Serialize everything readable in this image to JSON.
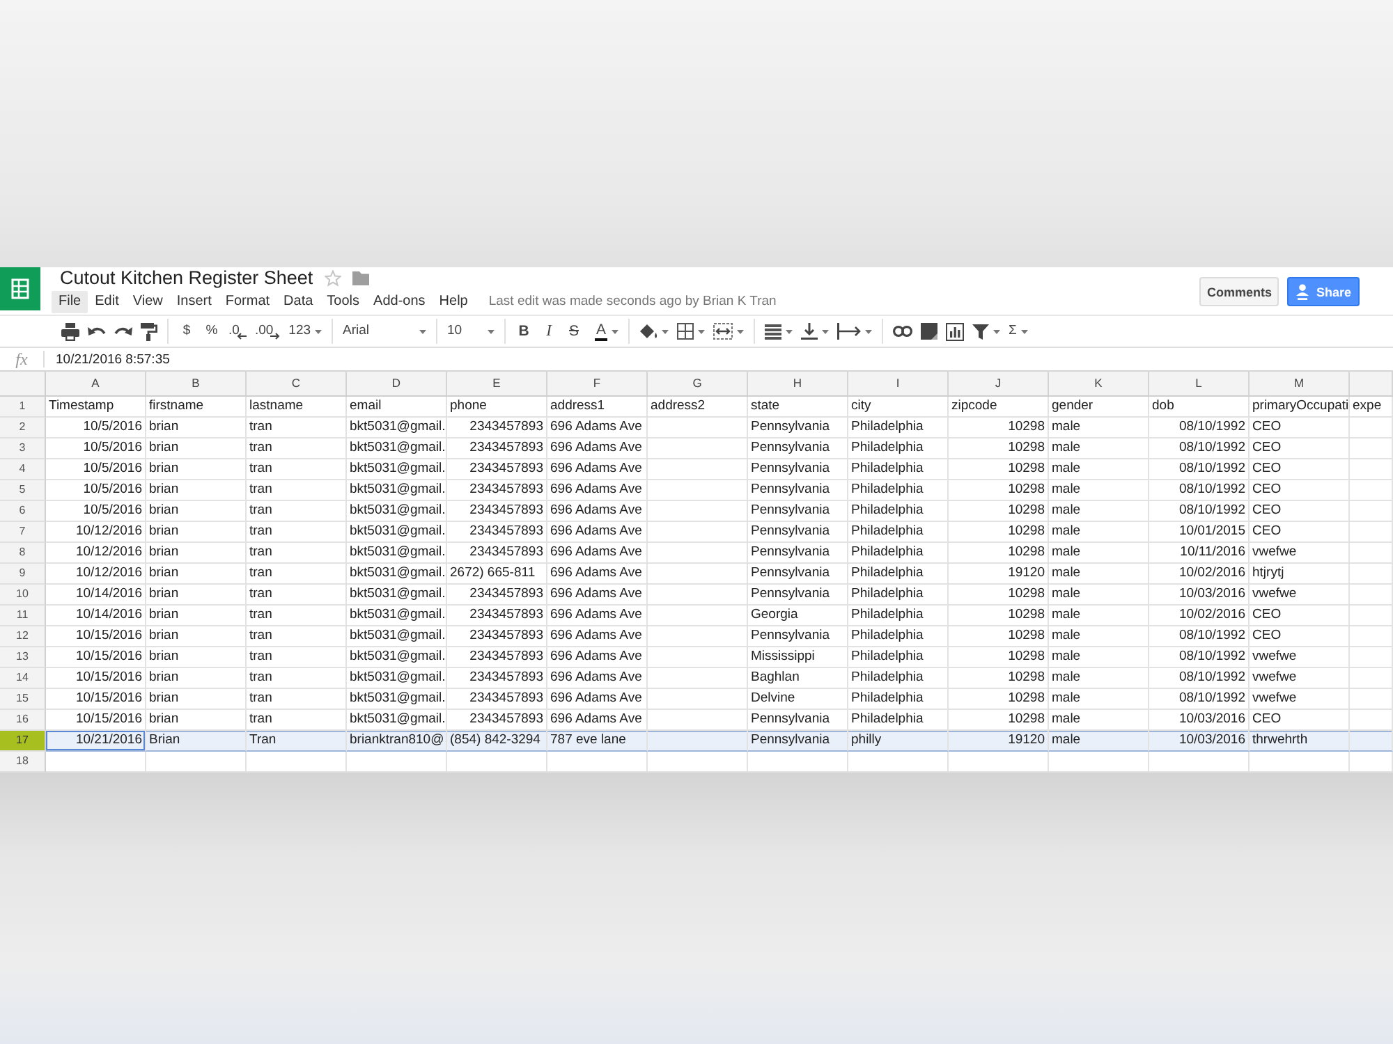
{
  "document": {
    "title": "Cutout Kitchen Register Sheet",
    "starred": false
  },
  "menu": [
    {
      "label": "File",
      "selected": true
    },
    {
      "label": "Edit",
      "selected": false
    },
    {
      "label": "View",
      "selected": false
    },
    {
      "label": "Insert",
      "selected": false
    },
    {
      "label": "Format",
      "selected": false
    },
    {
      "label": "Data",
      "selected": false
    },
    {
      "label": "Tools",
      "selected": false
    },
    {
      "label": "Add-ons",
      "selected": false
    },
    {
      "label": "Help",
      "selected": false
    }
  ],
  "last_edit": "Last edit was made seconds ago by Brian K Tran",
  "header_buttons": [
    {
      "label": "Comments",
      "kind": "plain"
    },
    {
      "label": "Share",
      "kind": "primary"
    }
  ],
  "toolbar": [
    [
      {
        "kind": "icon"
      },
      {
        "kind": "icon"
      },
      {
        "kind": "icon"
      },
      {
        "kind": "icon"
      }
    ],
    [
      {
        "kind": "glyph",
        "text": "$"
      },
      {
        "kind": "glyph",
        "text": "%"
      },
      {
        "kind": "shiftleft",
        "text": ".0"
      },
      {
        "kind": "shiftright",
        "text": ".00"
      },
      {
        "kind": "glyphmenu",
        "text": "123"
      }
    ],
    [
      {
        "kind": "select",
        "text": "Arial"
      }
    ],
    [
      {
        "kind": "select",
        "text": "10"
      }
    ],
    [
      {
        "kind": "bold",
        "text": "B"
      },
      {
        "kind": "italic",
        "text": "I"
      },
      {
        "kind": "strike",
        "text": "S"
      },
      {
        "kind": "colormenu",
        "text": "A"
      }
    ],
    [
      {
        "kind": "iconmenu"
      },
      {
        "kind": "iconmenu"
      },
      {
        "kind": "iconmenu"
      }
    ],
    [
      {
        "kind": "iconmenu"
      },
      {
        "kind": "iconmenu"
      },
      {
        "kind": "iconmenu"
      }
    ],
    [
      {
        "kind": "icon"
      },
      {
        "kind": "icon"
      },
      {
        "kind": "icon"
      },
      {
        "kind": "iconmenu"
      },
      {
        "kind": "glyphmenu",
        "text": "Σ"
      }
    ]
  ],
  "formula_bar": {
    "label": "fx",
    "value": "10/21/2016 8:57:35"
  },
  "grid": {
    "columns": [
      "A",
      "B",
      "C",
      "D",
      "E",
      "F",
      "G",
      "H",
      "I",
      "J",
      "K",
      "L",
      "M"
    ],
    "rows": [
      {
        "number": "1",
        "selected": false,
        "cells": [
          {
            "kind": "text",
            "text": "Timestamp",
            "active": false
          },
          {
            "kind": "text",
            "text": "firstname",
            "active": false
          },
          {
            "kind": "text",
            "text": "lastname",
            "active": false
          },
          {
            "kind": "text",
            "text": "email",
            "active": false
          },
          {
            "kind": "text",
            "text": "phone",
            "active": false
          },
          {
            "kind": "text",
            "text": "address1",
            "active": false
          },
          {
            "kind": "text",
            "text": "address2",
            "active": false
          },
          {
            "kind": "text",
            "text": "state",
            "active": false
          },
          {
            "kind": "text",
            "text": "city",
            "active": false
          },
          {
            "kind": "text",
            "text": "zipcode",
            "active": false
          },
          {
            "kind": "text",
            "text": "gender",
            "active": false
          },
          {
            "kind": "text",
            "text": "dob",
            "active": false
          },
          {
            "kind": "text",
            "text": "primaryOccupati",
            "active": false
          },
          {
            "kind": "text",
            "text": "expe",
            "active": false
          }
        ]
      },
      {
        "number": "2",
        "selected": false,
        "cells": [
          {
            "kind": "number",
            "text": "10/5/2016",
            "active": false
          },
          {
            "kind": "text",
            "text": "brian",
            "active": false
          },
          {
            "kind": "text",
            "text": "tran",
            "active": false
          },
          {
            "kind": "text",
            "text": "bkt5031@gmail.",
            "active": false
          },
          {
            "kind": "number",
            "text": "2343457893",
            "active": false
          },
          {
            "kind": "text",
            "text": "696 Adams Ave",
            "active": false
          },
          {
            "kind": "empty",
            "active": false
          },
          {
            "kind": "text",
            "text": "Pennsylvania",
            "active": false
          },
          {
            "kind": "text",
            "text": "Philadelphia",
            "active": false
          },
          {
            "kind": "number",
            "text": "10298",
            "active": false
          },
          {
            "kind": "text",
            "text": "male",
            "active": false
          },
          {
            "kind": "number",
            "text": "08/10/1992",
            "active": false
          },
          {
            "kind": "text",
            "text": "CEO",
            "active": false
          }
        ]
      },
      {
        "number": "3",
        "selected": false,
        "cells": [
          {
            "kind": "number",
            "text": "10/5/2016",
            "active": false
          },
          {
            "kind": "text",
            "text": "brian",
            "active": false
          },
          {
            "kind": "text",
            "text": "tran",
            "active": false
          },
          {
            "kind": "text",
            "text": "bkt5031@gmail.",
            "active": false
          },
          {
            "kind": "number",
            "text": "2343457893",
            "active": false
          },
          {
            "kind": "text",
            "text": "696 Adams Ave",
            "active": false
          },
          {
            "kind": "empty",
            "active": false
          },
          {
            "kind": "text",
            "text": "Pennsylvania",
            "active": false
          },
          {
            "kind": "text",
            "text": "Philadelphia",
            "active": false
          },
          {
            "kind": "number",
            "text": "10298",
            "active": false
          },
          {
            "kind": "text",
            "text": "male",
            "active": false
          },
          {
            "kind": "number",
            "text": "08/10/1992",
            "active": false
          },
          {
            "kind": "text",
            "text": "CEO",
            "active": false
          }
        ]
      },
      {
        "number": "4",
        "selected": false,
        "cells": [
          {
            "kind": "number",
            "text": "10/5/2016",
            "active": false
          },
          {
            "kind": "text",
            "text": "brian",
            "active": false
          },
          {
            "kind": "text",
            "text": "tran",
            "active": false
          },
          {
            "kind": "text",
            "text": "bkt5031@gmail.",
            "active": false
          },
          {
            "kind": "number",
            "text": "2343457893",
            "active": false
          },
          {
            "kind": "text",
            "text": "696 Adams Ave",
            "active": false
          },
          {
            "kind": "empty",
            "active": false
          },
          {
            "kind": "text",
            "text": "Pennsylvania",
            "active": false
          },
          {
            "kind": "text",
            "text": "Philadelphia",
            "active": false
          },
          {
            "kind": "number",
            "text": "10298",
            "active": false
          },
          {
            "kind": "text",
            "text": "male",
            "active": false
          },
          {
            "kind": "number",
            "text": "08/10/1992",
            "active": false
          },
          {
            "kind": "text",
            "text": "CEO",
            "active": false
          }
        ]
      },
      {
        "number": "5",
        "selected": false,
        "cells": [
          {
            "kind": "number",
            "text": "10/5/2016",
            "active": false
          },
          {
            "kind": "text",
            "text": "brian",
            "active": false
          },
          {
            "kind": "text",
            "text": "tran",
            "active": false
          },
          {
            "kind": "text",
            "text": "bkt5031@gmail.",
            "active": false
          },
          {
            "kind": "number",
            "text": "2343457893",
            "active": false
          },
          {
            "kind": "text",
            "text": "696 Adams Ave",
            "active": false
          },
          {
            "kind": "empty",
            "active": false
          },
          {
            "kind": "text",
            "text": "Pennsylvania",
            "active": false
          },
          {
            "kind": "text",
            "text": "Philadelphia",
            "active": false
          },
          {
            "kind": "number",
            "text": "10298",
            "active": false
          },
          {
            "kind": "text",
            "text": "male",
            "active": false
          },
          {
            "kind": "number",
            "text": "08/10/1992",
            "active": false
          },
          {
            "kind": "text",
            "text": "CEO",
            "active": false
          }
        ]
      },
      {
        "number": "6",
        "selected": false,
        "cells": [
          {
            "kind": "number",
            "text": "10/5/2016",
            "active": false
          },
          {
            "kind": "text",
            "text": "brian",
            "active": false
          },
          {
            "kind": "text",
            "text": "tran",
            "active": false
          },
          {
            "kind": "text",
            "text": "bkt5031@gmail.",
            "active": false
          },
          {
            "kind": "number",
            "text": "2343457893",
            "active": false
          },
          {
            "kind": "text",
            "text": "696 Adams Ave",
            "active": false
          },
          {
            "kind": "empty",
            "active": false
          },
          {
            "kind": "text",
            "text": "Pennsylvania",
            "active": false
          },
          {
            "kind": "text",
            "text": "Philadelphia",
            "active": false
          },
          {
            "kind": "number",
            "text": "10298",
            "active": false
          },
          {
            "kind": "text",
            "text": "male",
            "active": false
          },
          {
            "kind": "number",
            "text": "08/10/1992",
            "active": false
          },
          {
            "kind": "text",
            "text": "CEO",
            "active": false
          }
        ]
      },
      {
        "number": "7",
        "selected": false,
        "cells": [
          {
            "kind": "number",
            "text": "10/12/2016",
            "active": false
          },
          {
            "kind": "text",
            "text": "brian",
            "active": false
          },
          {
            "kind": "text",
            "text": "tran",
            "active": false
          },
          {
            "kind": "text",
            "text": "bkt5031@gmail.",
            "active": false
          },
          {
            "kind": "number",
            "text": "2343457893",
            "active": false
          },
          {
            "kind": "text",
            "text": "696 Adams Ave",
            "active": false
          },
          {
            "kind": "empty",
            "active": false
          },
          {
            "kind": "text",
            "text": "Pennsylvania",
            "active": false
          },
          {
            "kind": "text",
            "text": "Philadelphia",
            "active": false
          },
          {
            "kind": "number",
            "text": "10298",
            "active": false
          },
          {
            "kind": "text",
            "text": "male",
            "active": false
          },
          {
            "kind": "number",
            "text": "10/01/2015",
            "active": false
          },
          {
            "kind": "text",
            "text": "CEO",
            "active": false
          }
        ]
      },
      {
        "number": "8",
        "selected": false,
        "cells": [
          {
            "kind": "number",
            "text": "10/12/2016",
            "active": false
          },
          {
            "kind": "text",
            "text": "brian",
            "active": false
          },
          {
            "kind": "text",
            "text": "tran",
            "active": false
          },
          {
            "kind": "text",
            "text": "bkt5031@gmail.",
            "active": false
          },
          {
            "kind": "number",
            "text": "2343457893",
            "active": false
          },
          {
            "kind": "text",
            "text": "696 Adams Ave",
            "active": false
          },
          {
            "kind": "empty",
            "active": false
          },
          {
            "kind": "text",
            "text": "Pennsylvania",
            "active": false
          },
          {
            "kind": "text",
            "text": "Philadelphia",
            "active": false
          },
          {
            "kind": "number",
            "text": "10298",
            "active": false
          },
          {
            "kind": "text",
            "text": "male",
            "active": false
          },
          {
            "kind": "number",
            "text": "10/11/2016",
            "active": false
          },
          {
            "kind": "text",
            "text": "vwefwe",
            "active": false
          }
        ]
      },
      {
        "number": "9",
        "selected": false,
        "cells": [
          {
            "kind": "number",
            "text": "10/12/2016",
            "active": false
          },
          {
            "kind": "text",
            "text": "brian",
            "active": false
          },
          {
            "kind": "text",
            "text": "tran",
            "active": false
          },
          {
            "kind": "text",
            "text": "bkt5031@gmail.",
            "active": false
          },
          {
            "kind": "text",
            "text": "2672) 665-811",
            "active": false
          },
          {
            "kind": "text",
            "text": "696 Adams Ave",
            "active": false
          },
          {
            "kind": "empty",
            "active": false
          },
          {
            "kind": "text",
            "text": "Pennsylvania",
            "active": false
          },
          {
            "kind": "text",
            "text": "Philadelphia",
            "active": false
          },
          {
            "kind": "number",
            "text": "19120",
            "active": false
          },
          {
            "kind": "text",
            "text": "male",
            "active": false
          },
          {
            "kind": "number",
            "text": "10/02/2016",
            "active": false
          },
          {
            "kind": "text",
            "text": "htjrytj",
            "active": false
          }
        ]
      },
      {
        "number": "10",
        "selected": false,
        "cells": [
          {
            "kind": "number",
            "text": "10/14/2016",
            "active": false
          },
          {
            "kind": "text",
            "text": "brian",
            "active": false
          },
          {
            "kind": "text",
            "text": "tran",
            "active": false
          },
          {
            "kind": "text",
            "text": "bkt5031@gmail.",
            "active": false
          },
          {
            "kind": "number",
            "text": "2343457893",
            "active": false
          },
          {
            "kind": "text",
            "text": "696 Adams Ave",
            "active": false
          },
          {
            "kind": "empty",
            "active": false
          },
          {
            "kind": "text",
            "text": "Pennsylvania",
            "active": false
          },
          {
            "kind": "text",
            "text": "Philadelphia",
            "active": false
          },
          {
            "kind": "number",
            "text": "10298",
            "active": false
          },
          {
            "kind": "text",
            "text": "male",
            "active": false
          },
          {
            "kind": "number",
            "text": "10/03/2016",
            "active": false
          },
          {
            "kind": "text",
            "text": "vwefwe",
            "active": false
          }
        ]
      },
      {
        "number": "11",
        "selected": false,
        "cells": [
          {
            "kind": "number",
            "text": "10/14/2016",
            "active": false
          },
          {
            "kind": "text",
            "text": "brian",
            "active": false
          },
          {
            "kind": "text",
            "text": "tran",
            "active": false
          },
          {
            "kind": "text",
            "text": "bkt5031@gmail.",
            "active": false
          },
          {
            "kind": "number",
            "text": "2343457893",
            "active": false
          },
          {
            "kind": "text",
            "text": "696 Adams Ave",
            "active": false
          },
          {
            "kind": "empty",
            "active": false
          },
          {
            "kind": "text",
            "text": "Georgia",
            "active": false
          },
          {
            "kind": "text",
            "text": "Philadelphia",
            "active": false
          },
          {
            "kind": "number",
            "text": "10298",
            "active": false
          },
          {
            "kind": "text",
            "text": "male",
            "active": false
          },
          {
            "kind": "number",
            "text": "10/02/2016",
            "active": false
          },
          {
            "kind": "text",
            "text": "CEO",
            "active": false
          }
        ]
      },
      {
        "number": "12",
        "selected": false,
        "cells": [
          {
            "kind": "number",
            "text": "10/15/2016",
            "active": false
          },
          {
            "kind": "text",
            "text": "brian",
            "active": false
          },
          {
            "kind": "text",
            "text": "tran",
            "active": false
          },
          {
            "kind": "text",
            "text": "bkt5031@gmail.",
            "active": false
          },
          {
            "kind": "number",
            "text": "2343457893",
            "active": false
          },
          {
            "kind": "text",
            "text": "696 Adams Ave",
            "active": false
          },
          {
            "kind": "empty",
            "active": false
          },
          {
            "kind": "text",
            "text": "Pennsylvania",
            "active": false
          },
          {
            "kind": "text",
            "text": "Philadelphia",
            "active": false
          },
          {
            "kind": "number",
            "text": "10298",
            "active": false
          },
          {
            "kind": "text",
            "text": "male",
            "active": false
          },
          {
            "kind": "number",
            "text": "08/10/1992",
            "active": false
          },
          {
            "kind": "text",
            "text": "CEO",
            "active": false
          }
        ]
      },
      {
        "number": "13",
        "selected": false,
        "cells": [
          {
            "kind": "number",
            "text": "10/15/2016",
            "active": false
          },
          {
            "kind": "text",
            "text": "brian",
            "active": false
          },
          {
            "kind": "text",
            "text": "tran",
            "active": false
          },
          {
            "kind": "text",
            "text": "bkt5031@gmail.",
            "active": false
          },
          {
            "kind": "number",
            "text": "2343457893",
            "active": false
          },
          {
            "kind": "text",
            "text": "696 Adams Ave",
            "active": false
          },
          {
            "kind": "empty",
            "active": false
          },
          {
            "kind": "text",
            "text": "Mississippi",
            "active": false
          },
          {
            "kind": "text",
            "text": "Philadelphia",
            "active": false
          },
          {
            "kind": "number",
            "text": "10298",
            "active": false
          },
          {
            "kind": "text",
            "text": "male",
            "active": false
          },
          {
            "kind": "number",
            "text": "08/10/1992",
            "active": false
          },
          {
            "kind": "text",
            "text": "vwefwe",
            "active": false
          }
        ]
      },
      {
        "number": "14",
        "selected": false,
        "cells": [
          {
            "kind": "number",
            "text": "10/15/2016",
            "active": false
          },
          {
            "kind": "text",
            "text": "brian",
            "active": false
          },
          {
            "kind": "text",
            "text": "tran",
            "active": false
          },
          {
            "kind": "text",
            "text": "bkt5031@gmail.",
            "active": false
          },
          {
            "kind": "number",
            "text": "2343457893",
            "active": false
          },
          {
            "kind": "text",
            "text": "696 Adams Ave",
            "active": false
          },
          {
            "kind": "empty",
            "active": false
          },
          {
            "kind": "text",
            "text": "Baghlan",
            "active": false
          },
          {
            "kind": "text",
            "text": "Philadelphia",
            "active": false
          },
          {
            "kind": "number",
            "text": "10298",
            "active": false
          },
          {
            "kind": "text",
            "text": "male",
            "active": false
          },
          {
            "kind": "number",
            "text": "08/10/1992",
            "active": false
          },
          {
            "kind": "text",
            "text": "vwefwe",
            "active": false
          }
        ]
      },
      {
        "number": "15",
        "selected": false,
        "cells": [
          {
            "kind": "number",
            "text": "10/15/2016",
            "active": false
          },
          {
            "kind": "text",
            "text": "brian",
            "active": false
          },
          {
            "kind": "text",
            "text": "tran",
            "active": false
          },
          {
            "kind": "text",
            "text": "bkt5031@gmail.",
            "active": false
          },
          {
            "kind": "number",
            "text": "2343457893",
            "active": false
          },
          {
            "kind": "text",
            "text": "696 Adams Ave",
            "active": false
          },
          {
            "kind": "empty",
            "active": false
          },
          {
            "kind": "text",
            "text": "Delvine",
            "active": false
          },
          {
            "kind": "text",
            "text": "Philadelphia",
            "active": false
          },
          {
            "kind": "number",
            "text": "10298",
            "active": false
          },
          {
            "kind": "text",
            "text": "male",
            "active": false
          },
          {
            "kind": "number",
            "text": "08/10/1992",
            "active": false
          },
          {
            "kind": "text",
            "text": "vwefwe",
            "active": false
          }
        ]
      },
      {
        "number": "16",
        "selected": false,
        "cells": [
          {
            "kind": "number",
            "text": "10/15/2016",
            "active": false
          },
          {
            "kind": "text",
            "text": "brian",
            "active": false
          },
          {
            "kind": "text",
            "text": "tran",
            "active": false
          },
          {
            "kind": "text",
            "text": "bkt5031@gmail.",
            "active": false
          },
          {
            "kind": "number",
            "text": "2343457893",
            "active": false
          },
          {
            "kind": "text",
            "text": "696 Adams Ave",
            "active": false
          },
          {
            "kind": "empty",
            "active": false
          },
          {
            "kind": "text",
            "text": "Pennsylvania",
            "active": false
          },
          {
            "kind": "text",
            "text": "Philadelphia",
            "active": false
          },
          {
            "kind": "number",
            "text": "10298",
            "active": false
          },
          {
            "kind": "text",
            "text": "male",
            "active": false
          },
          {
            "kind": "number",
            "text": "10/03/2016",
            "active": false
          },
          {
            "kind": "text",
            "text": "CEO",
            "active": false
          }
        ]
      },
      {
        "number": "17",
        "selected": true,
        "cells": [
          {
            "kind": "number",
            "text": "10/21/2016",
            "active": true
          },
          {
            "kind": "text",
            "text": "Brian",
            "active": false
          },
          {
            "kind": "text",
            "text": "Tran",
            "active": false
          },
          {
            "kind": "text",
            "text": "brianktran810@",
            "active": false
          },
          {
            "kind": "text",
            "text": "(854) 842-3294",
            "active": false
          },
          {
            "kind": "text",
            "text": "787 eve lane",
            "active": false
          },
          {
            "kind": "empty",
            "active": false
          },
          {
            "kind": "text",
            "text": "Pennsylvania",
            "active": false
          },
          {
            "kind": "text",
            "text": "philly",
            "active": false
          },
          {
            "kind": "number",
            "text": "19120",
            "active": false
          },
          {
            "kind": "text",
            "text": "male",
            "active": false
          },
          {
            "kind": "number",
            "text": "10/03/2016",
            "active": false
          },
          {
            "kind": "text",
            "text": "thrwehrth",
            "active": false
          }
        ]
      },
      {
        "number": "18",
        "selected": false
      }
    ]
  }
}
